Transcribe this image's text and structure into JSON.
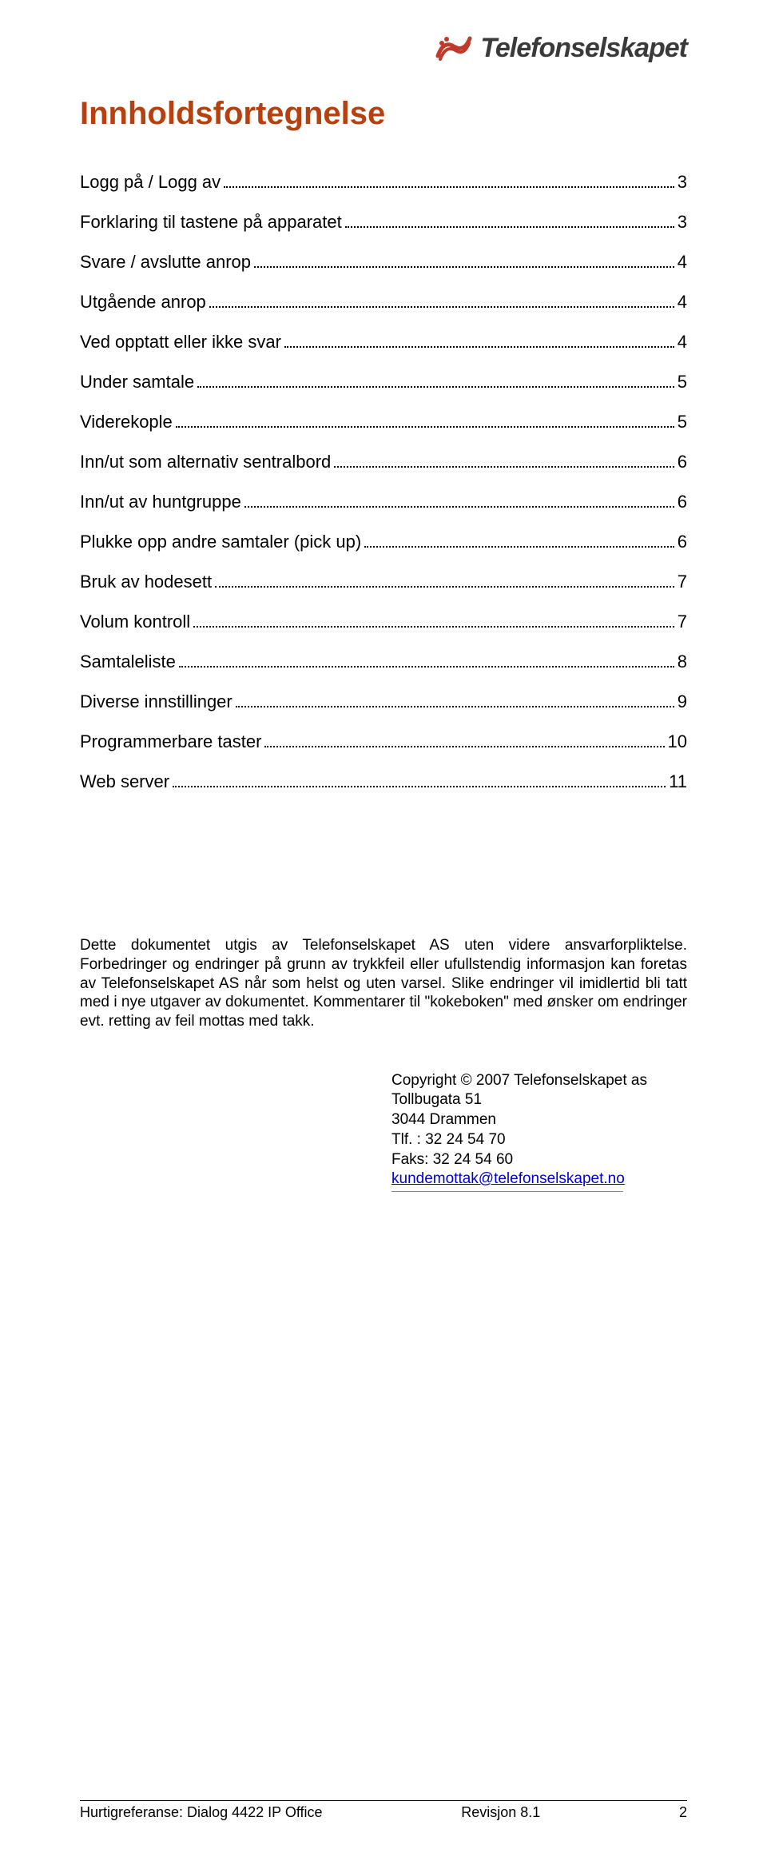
{
  "header": {
    "logo_text": "Telefonselskapet"
  },
  "title": "Innholdsfortegnelse",
  "toc": [
    {
      "label": "Logg på / Logg av",
      "page": "3"
    },
    {
      "label": "Forklaring til tastene på apparatet",
      "page": "3"
    },
    {
      "label": "Svare / avslutte anrop",
      "page": "4"
    },
    {
      "label": "Utgående anrop",
      "page": "4"
    },
    {
      "label": "Ved opptatt eller ikke svar",
      "page": "4"
    },
    {
      "label": "Under samtale",
      "page": "5"
    },
    {
      "label": "Viderekople",
      "page": "5"
    },
    {
      "label": "Inn/ut som alternativ sentralbord",
      "page": "6"
    },
    {
      "label": "Inn/ut av huntgruppe",
      "page": "6"
    },
    {
      "label": "Plukke opp andre samtaler (pick up)",
      "page": "6"
    },
    {
      "label": "Bruk av hodesett",
      "page": "7"
    },
    {
      "label": "Volum kontroll",
      "page": "7"
    },
    {
      "label": "Samtaleliste",
      "page": "8"
    },
    {
      "label": "Diverse innstillinger",
      "page": "9"
    },
    {
      "label": "Programmerbare taster",
      "page": "10"
    },
    {
      "label": "Web server",
      "page": "11"
    }
  ],
  "disclaimer": "Dette dokumentet utgis av Telefonselskapet AS uten videre ansvarforpliktelse. Forbedringer og endringer på grunn av trykkfeil eller ufullstendig informasjon kan foretas av Telefonselskapet AS når som helst og uten varsel. Slike endringer vil imidlertid bli tatt med i nye utgaver av dokumentet. Kommentarer til \"kokeboken\" med ønsker om endringer evt. retting av feil mottas med takk.",
  "copyright": {
    "line1": "Copyright © 2007 Telefonselskapet as",
    "line2": "Tollbugata 51",
    "line3": " 3044 Drammen",
    "line4": "Tlf. :   32 24 54 70",
    "line5": "Faks:  32 24 54 60",
    "email": "kundemottak@telefonselskapet.no"
  },
  "footer": {
    "left": "Hurtigreferanse: Dialog 4422 IP Office",
    "center": "Revisjon 8.1",
    "right": "2"
  }
}
